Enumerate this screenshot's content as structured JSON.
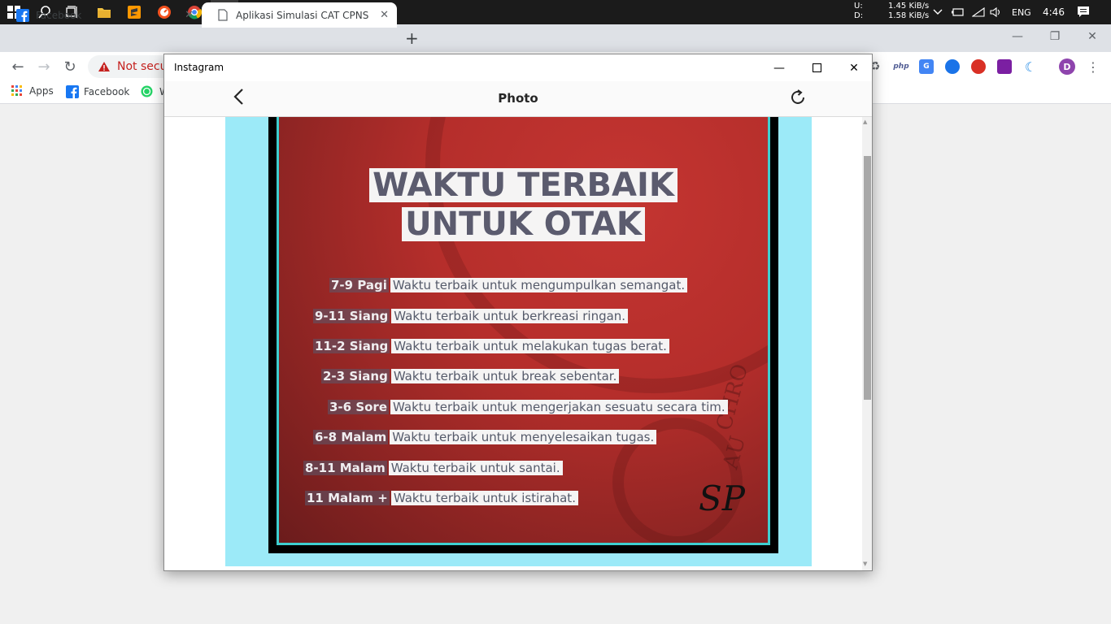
{
  "taskbar": {
    "net_up": "U:",
    "net_down": "D:",
    "net_up_speed": "1.45 KiB/s",
    "net_down_speed": "1.58 KiB/s",
    "language": "ENG",
    "clock": "4:46"
  },
  "browser": {
    "tabs": [
      {
        "label": "Facebook",
        "icon": "facebook-icon"
      },
      {
        "label": "Aplikasi Simulasi CAT CPNS",
        "icon": "page-icon"
      }
    ],
    "omnibox_text": "Not secur",
    "bookmarks": [
      {
        "label": "Apps",
        "icon": "apps-grid-icon"
      },
      {
        "label": "Facebook",
        "icon": "facebook-icon"
      },
      {
        "label": "W",
        "icon": "whatsapp-icon"
      }
    ],
    "extensions": [
      {
        "label": "php",
        "color": "#4f5b93"
      },
      {
        "label": "G",
        "color": "#4285f4"
      },
      {
        "label": "",
        "color": "#1a73e8"
      },
      {
        "label": "",
        "color": "#d93025"
      },
      {
        "label": "",
        "color": "#7b1fa2"
      },
      {
        "label": "",
        "color": "#1e88e5"
      }
    ],
    "profile_initial": "D"
  },
  "popup": {
    "window_title": "Instagram",
    "header_title": "Photo",
    "poster": {
      "headline_line1": "WAKTU TERBAIK",
      "headline_line2": "UNTUK OTAK",
      "schedule": [
        {
          "time": "7-9 Pagi",
          "desc": "Waktu terbaik untuk mengumpulkan semangat."
        },
        {
          "time": "9-11 Siang",
          "desc": "Waktu terbaik untuk berkreasi ringan."
        },
        {
          "time": "11-2 Siang",
          "desc": "Waktu terbaik untuk melakukan tugas berat."
        },
        {
          "time": "2-3 Siang",
          "desc": "Waktu terbaik untuk break sebentar."
        },
        {
          "time": "3-6 Sore",
          "desc": "Waktu terbaik untuk mengerjakan sesuatu secara tim."
        },
        {
          "time": "6-8 Malam",
          "desc": "Waktu terbaik untuk menyelesaikan tugas."
        },
        {
          "time": "8-11 Malam",
          "desc": "Waktu terbaik untuk santai."
        },
        {
          "time": "11 Malam +",
          "desc": "Waktu terbaik untuk istirahat."
        }
      ],
      "signature": "SP",
      "watermark_text_1": "CHRO",
      "watermark_text_2": "AU"
    }
  }
}
